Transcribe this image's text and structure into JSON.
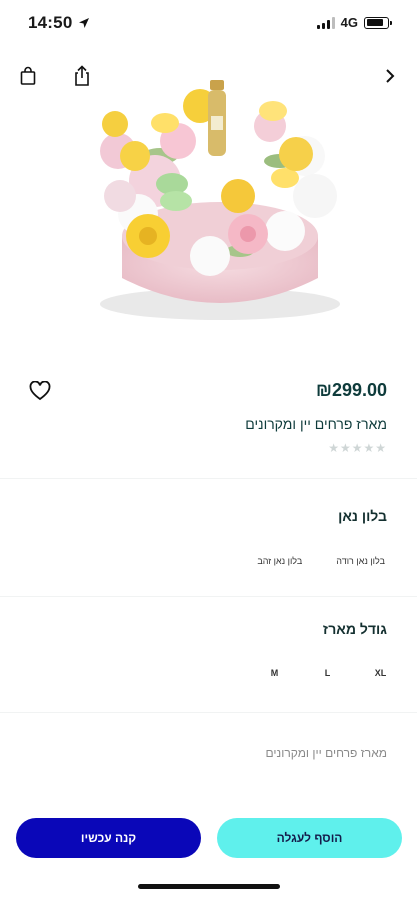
{
  "status_bar": {
    "time": "14:50",
    "network": "4G",
    "battery_level_pct": 80
  },
  "toolbar": {
    "icons": [
      "shopping-bag-icon",
      "share-icon",
      "chevron-right-icon"
    ]
  },
  "product": {
    "price": "₪299.00",
    "title": "מארז פרחים יין ומקרונים",
    "rating_stars": "★★★★★",
    "rating_value": 0,
    "description": "מארז פרחים יין ומקרונים"
  },
  "options": {
    "balloon": {
      "label": "בלון נאן",
      "values": [
        "בלון נאן זהב",
        "בלון נאן רודה"
      ]
    },
    "size": {
      "label": "גודל מארז",
      "values": [
        "M",
        "L",
        "XL"
      ]
    }
  },
  "actions": {
    "add_to_cart": "הוסף לעגלה",
    "buy_now": "קנה עכשיו"
  },
  "colors": {
    "buy_now_bg": "#0a07b8",
    "add_to_cart_bg": "#5ff0ec",
    "price_text": "#0e3b3b"
  }
}
